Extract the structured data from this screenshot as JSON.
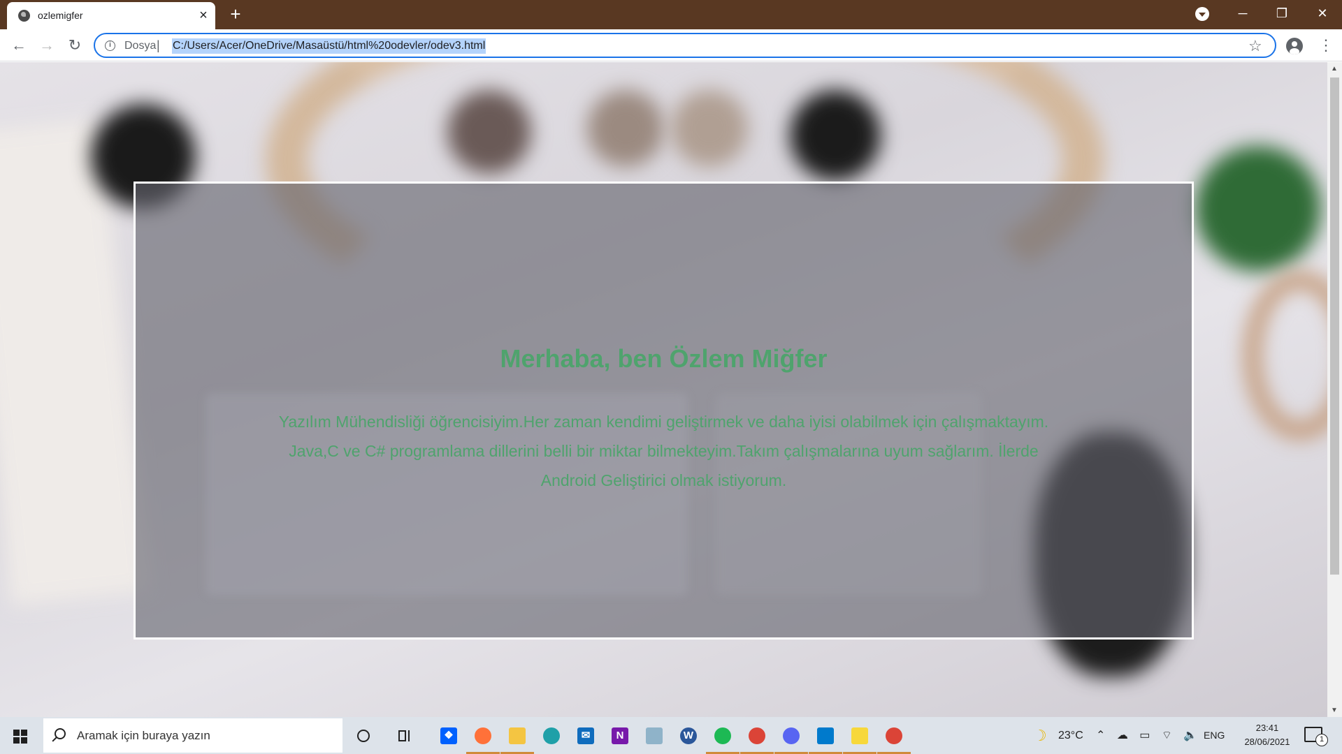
{
  "browser": {
    "tab": {
      "title": "ozlemigfer",
      "close_glyph": "×"
    },
    "new_tab_glyph": "+",
    "window_controls": {
      "minimize": "─",
      "maximize": "❐",
      "close": "✕"
    },
    "nav": {
      "back": "←",
      "forward": "→",
      "reload": "↻"
    },
    "address": {
      "info_glyph": "i",
      "scheme": "Dosya",
      "separator": "|",
      "url": "C:/Users/Acer/OneDrive/Masaüstü/html%20odevler/odev3.html"
    },
    "bookmark_glyph": "☆",
    "menu_glyph": "⋮",
    "accent": "#1a73e8",
    "frame_color": "#593822"
  },
  "page": {
    "heading": "Merhaba, ben Özlem Miğfer",
    "body": "Yazılım Mühendisliği öğrencisiyim.Her zaman kendimi geliştirmek ve daha iyisi olabilmek için çalışmaktayım. Java,C ve C# programlama dillerini belli bir miktar bilmekteyim.Takım çalışmalarına uyum sağlarım. İlerde Android Geliştirici olmak istiyorum.",
    "text_color": "#4fa36d",
    "panel_border": "#ffffff"
  },
  "taskbar": {
    "search_placeholder": "Aramak için buraya yazın",
    "apps": [
      {
        "name": "dropbox-icon",
        "glyph": "❖",
        "color": "#0061fe"
      },
      {
        "name": "firefox-icon",
        "glyph": "",
        "color": "#ff7139"
      },
      {
        "name": "file-explorer-icon",
        "glyph": "",
        "color": "#f4c542"
      },
      {
        "name": "edge-icon",
        "glyph": "",
        "color": "#1fa0a8"
      },
      {
        "name": "mail-icon",
        "glyph": "✉",
        "color": "#0f6cbd"
      },
      {
        "name": "onenote-icon",
        "glyph": "N",
        "color": "#7719aa"
      },
      {
        "name": "notes-icon",
        "glyph": "",
        "color": "#8fb3c9"
      },
      {
        "name": "word-icon",
        "glyph": "W",
        "color": "#2b579a"
      },
      {
        "name": "spotify-icon",
        "glyph": "",
        "color": "#1db954"
      },
      {
        "name": "chrome-icon",
        "glyph": "",
        "color": "#db4437"
      },
      {
        "name": "discord-icon",
        "glyph": "",
        "color": "#5865f2"
      },
      {
        "name": "vscode-icon",
        "glyph": "",
        "color": "#007acc"
      },
      {
        "name": "sticky-notes-icon",
        "glyph": "",
        "color": "#f7d83b"
      },
      {
        "name": "chrome-active-icon",
        "glyph": "",
        "color": "#db4437"
      }
    ],
    "weather": {
      "glyph": "☽",
      "temperature": "23°C"
    },
    "tray_icons": "⌃ ☁ ▭ ⌔ 🔈",
    "language": "ENG",
    "time": "23:41",
    "date": "28/06/2021",
    "notifications_count": "1"
  }
}
